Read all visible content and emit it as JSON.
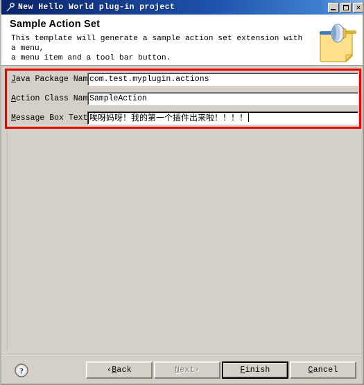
{
  "window": {
    "title": "New Hello World plug-in project",
    "title_icon": "plugin-wrench-icon",
    "controls": {
      "minimize": "minimize-button",
      "maximize": "maximize-button",
      "close_label": "✕"
    }
  },
  "header": {
    "title": "Sample Action Set",
    "description": "This template will generate a sample action set extension with a menu,\na menu item and a tool bar button.",
    "icon": "wizard-page-plugin-icon"
  },
  "form": {
    "highlight_color": "#ee0000",
    "fields": [
      {
        "mnemonic": "J",
        "label_rest": "ava Package Name:",
        "value": "com.test.myplugin.actions",
        "focused": false,
        "cjk": false
      },
      {
        "mnemonic": "A",
        "label_rest": "ction Class Name:",
        "value": "SampleAction",
        "focused": false,
        "cjk": false
      },
      {
        "mnemonic": "M",
        "label_rest": "essage Box Text:",
        "value": "唉呀妈呀！我的第一个插件出来啦！！！！",
        "focused": true,
        "cjk": true
      }
    ]
  },
  "buttonbar": {
    "help_icon": "help-question-icon",
    "buttons": [
      {
        "prefix": "‹ ",
        "mnemonic": "B",
        "rest": "ack",
        "suffix": "",
        "state": "enabled",
        "name": "back-button"
      },
      {
        "prefix": "",
        "mnemonic": "N",
        "rest": "ext",
        "suffix": " ›",
        "state": "disabled",
        "name": "next-button"
      },
      {
        "prefix": "",
        "mnemonic": "F",
        "rest": "inish",
        "suffix": "",
        "state": "default",
        "name": "finish-button"
      },
      {
        "prefix": "",
        "mnemonic": "C",
        "rest": "ancel",
        "suffix": "",
        "state": "enabled",
        "name": "cancel-button"
      }
    ]
  },
  "colors": {
    "titlebar_start": "#0a246a",
    "titlebar_end": "#8bb6e8",
    "dialog_face": "#d4d0c8",
    "banner": "#ffffff",
    "highlight": "#ee0000"
  }
}
